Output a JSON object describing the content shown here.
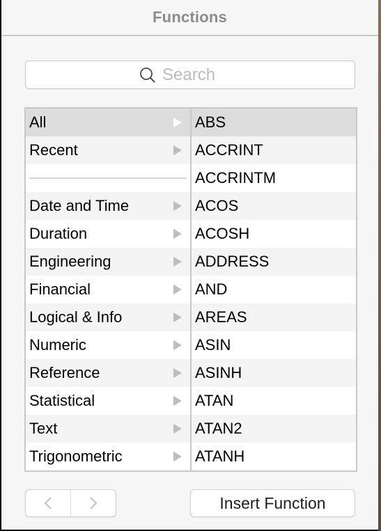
{
  "header": {
    "title": "Functions"
  },
  "search": {
    "placeholder": "Search",
    "value": ""
  },
  "categories": [
    {
      "label": "All",
      "selected": true
    },
    {
      "label": "Recent",
      "selected": false
    },
    {
      "separator": true
    },
    {
      "label": "Date and Time",
      "selected": false
    },
    {
      "label": "Duration",
      "selected": false
    },
    {
      "label": "Engineering",
      "selected": false
    },
    {
      "label": "Financial",
      "selected": false
    },
    {
      "label": "Logical & Info",
      "selected": false
    },
    {
      "label": "Numeric",
      "selected": false
    },
    {
      "label": "Reference",
      "selected": false
    },
    {
      "label": "Statistical",
      "selected": false
    },
    {
      "label": "Text",
      "selected": false
    },
    {
      "label": "Trigonometric",
      "selected": false
    }
  ],
  "functions": [
    {
      "label": "ABS",
      "selected": true
    },
    {
      "label": "ACCRINT",
      "selected": false
    },
    {
      "label": "ACCRINTM",
      "selected": false
    },
    {
      "label": "ACOS",
      "selected": false
    },
    {
      "label": "ACOSH",
      "selected": false
    },
    {
      "label": "ADDRESS",
      "selected": false
    },
    {
      "label": "AND",
      "selected": false
    },
    {
      "label": "AREAS",
      "selected": false
    },
    {
      "label": "ASIN",
      "selected": false
    },
    {
      "label": "ASINH",
      "selected": false
    },
    {
      "label": "ATAN",
      "selected": false
    },
    {
      "label": "ATAN2",
      "selected": false
    },
    {
      "label": "ATANH",
      "selected": false
    }
  ],
  "footer": {
    "back_icon": "chevron-left-icon",
    "forward_icon": "chevron-right-icon",
    "insert_label": "Insert Function"
  },
  "colors": {
    "selected_row": "#dcdcdc",
    "alt_row": "#f4f4f4",
    "header_text": "#8b8b8b",
    "arrow": "#bdbdbd"
  }
}
